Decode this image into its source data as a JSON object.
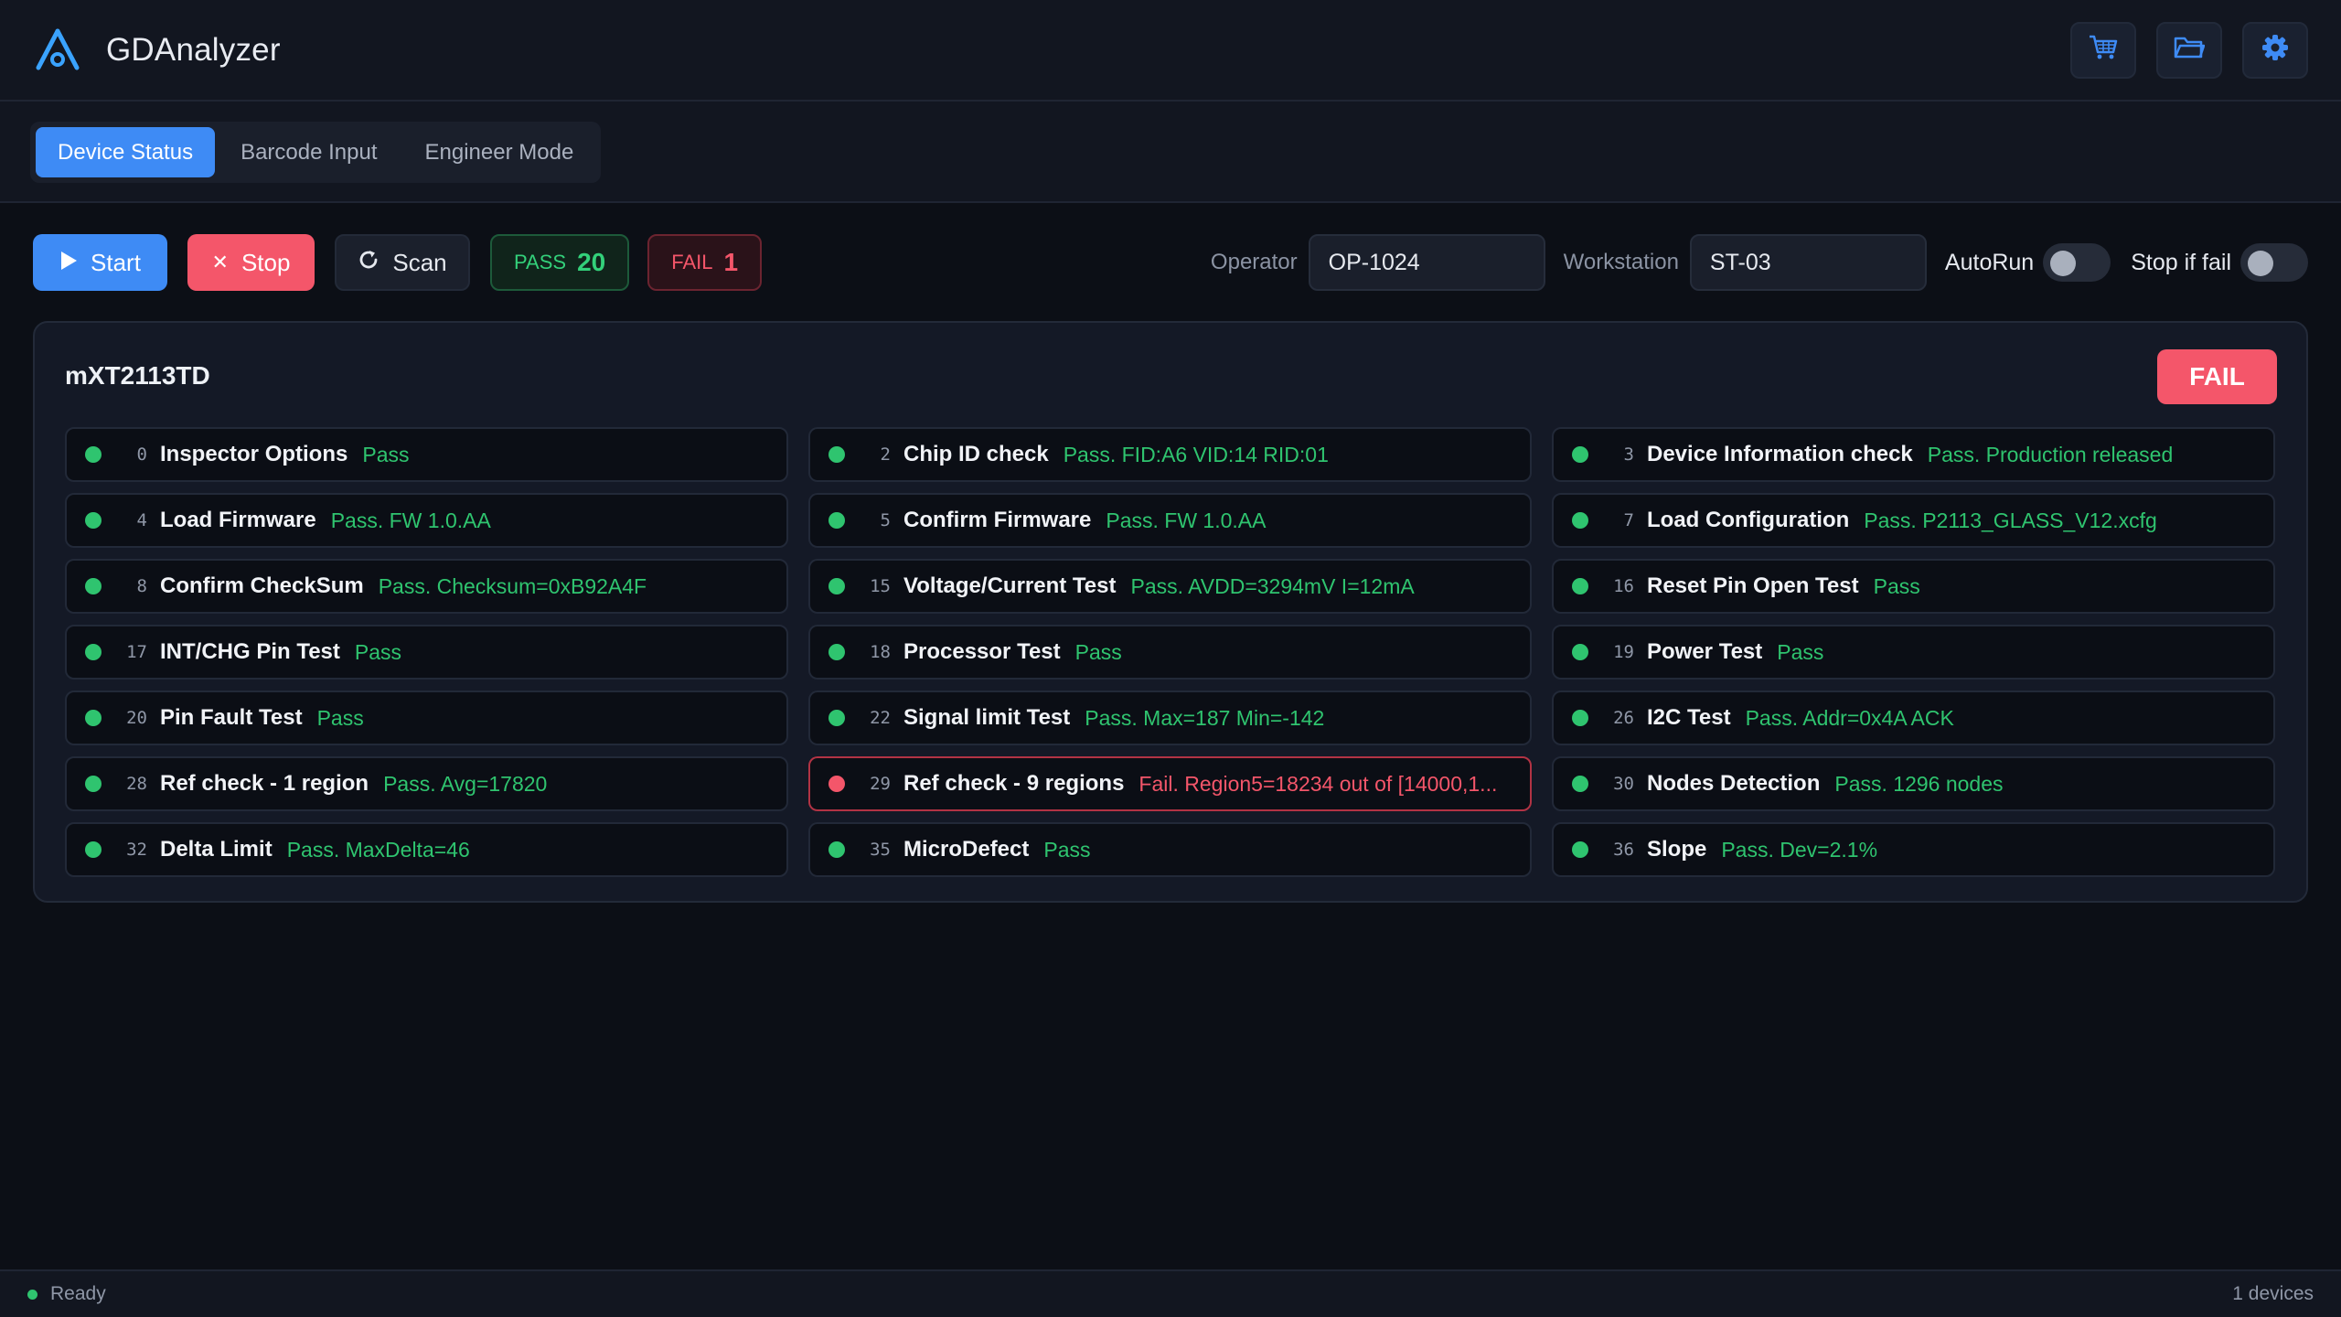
{
  "app": {
    "title": "GDAnalyzer",
    "accent": "#3e8bf5"
  },
  "header": {
    "actions": [
      {
        "name": "cart-icon",
        "label": ""
      },
      {
        "name": "folder-icon",
        "label": ""
      },
      {
        "name": "gear-icon",
        "label": ""
      }
    ]
  },
  "tabs": [
    {
      "label": "Device Status",
      "active": true
    },
    {
      "label": "Barcode Input",
      "active": false
    },
    {
      "label": "Engineer Mode",
      "active": false
    }
  ],
  "toolbar": {
    "start_label": "Start",
    "stop_label": "Stop",
    "scan_label": "Scan",
    "pass_label": "PASS",
    "pass_count": "20",
    "fail_label": "FAIL",
    "fail_count": "1",
    "operator_label": "Operator",
    "operator_value": "OP-1024",
    "workstation_label": "Workstation",
    "workstation_value": "ST-03",
    "autorun_label": "AutoRun",
    "autorun_on": false,
    "stopiffail_label": "Stop if fail",
    "stopiffail_on": false
  },
  "device": {
    "name": "mXT2113TD",
    "result": "FAIL",
    "colors": {
      "pass": "#2fc46f",
      "fail": "#f4566a"
    },
    "tests": [
      {
        "num": "0",
        "name": "Inspector Options",
        "result": "Pass",
        "status": "pass"
      },
      {
        "num": "2",
        "name": "Chip ID check",
        "result": "Pass. FID:A6 VID:14 RID:01",
        "status": "pass"
      },
      {
        "num": "3",
        "name": "Device Information check",
        "result": "Pass. Production released",
        "status": "pass"
      },
      {
        "num": "4",
        "name": "Load Firmware",
        "result": "Pass. FW 1.0.AA",
        "status": "pass"
      },
      {
        "num": "5",
        "name": "Confirm Firmware",
        "result": "Pass. FW 1.0.AA",
        "status": "pass"
      },
      {
        "num": "7",
        "name": "Load Configuration",
        "result": "Pass. P2113_GLASS_V12.xcfg",
        "status": "pass"
      },
      {
        "num": "8",
        "name": "Confirm CheckSum",
        "result": "Pass. Checksum=0xB92A4F",
        "status": "pass"
      },
      {
        "num": "15",
        "name": "Voltage/Current Test",
        "result": "Pass. AVDD=3294mV I=12mA",
        "status": "pass"
      },
      {
        "num": "16",
        "name": "Reset Pin Open Test",
        "result": "Pass",
        "status": "pass"
      },
      {
        "num": "17",
        "name": "INT/CHG Pin Test",
        "result": "Pass",
        "status": "pass"
      },
      {
        "num": "18",
        "name": "Processor Test",
        "result": "Pass",
        "status": "pass"
      },
      {
        "num": "19",
        "name": "Power Test",
        "result": "Pass",
        "status": "pass"
      },
      {
        "num": "20",
        "name": "Pin Fault Test",
        "result": "Pass",
        "status": "pass"
      },
      {
        "num": "22",
        "name": "Signal limit Test",
        "result": "Pass. Max=187 Min=-142",
        "status": "pass"
      },
      {
        "num": "26",
        "name": "I2C Test",
        "result": "Pass. Addr=0x4A ACK",
        "status": "pass"
      },
      {
        "num": "28",
        "name": "Ref check - 1 region",
        "result": "Pass. Avg=17820",
        "status": "pass"
      },
      {
        "num": "29",
        "name": "Ref check - 9 regions",
        "result": "Fail. Region5=18234 out of [14000,1...",
        "status": "fail"
      },
      {
        "num": "30",
        "name": "Nodes Detection",
        "result": "Pass. 1296 nodes",
        "status": "pass"
      },
      {
        "num": "32",
        "name": "Delta Limit",
        "result": "Pass. MaxDelta=46",
        "status": "pass"
      },
      {
        "num": "35",
        "name": "MicroDefect",
        "result": "Pass",
        "status": "pass"
      },
      {
        "num": "36",
        "name": "Slope",
        "result": "Pass. Dev=2.1%",
        "status": "pass"
      }
    ]
  },
  "statusbar": {
    "status": "Ready",
    "status_color": "#2fc46f",
    "devices": "1 devices"
  }
}
